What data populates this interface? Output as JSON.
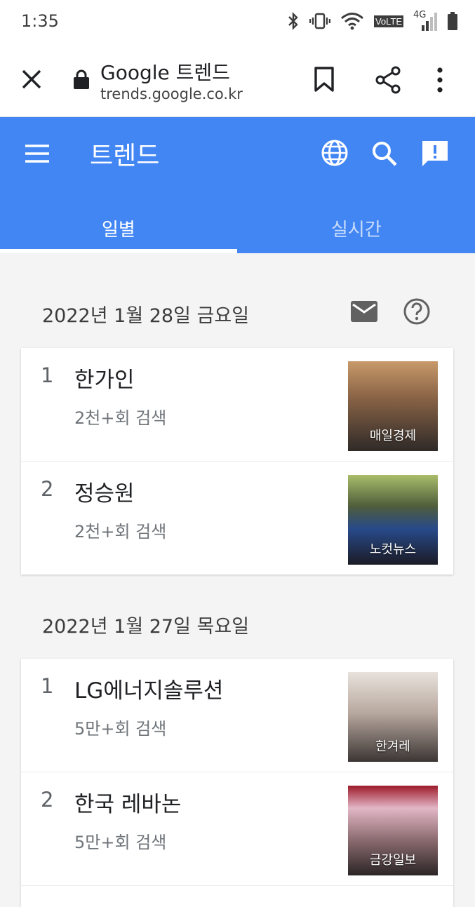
{
  "status_bar": {
    "time": "1:35",
    "network": "4G",
    "volte": "VoLTE",
    "icons": [
      "bluetooth-icon",
      "vibrate-icon",
      "wifi-icon",
      "volte-icon",
      "signal-icon",
      "battery-icon"
    ]
  },
  "browser": {
    "page_title": "Google 트렌드",
    "url": "trends.google.co.kr",
    "icons": [
      "close-icon",
      "lock-icon",
      "bookmark-icon",
      "share-icon",
      "more-icon"
    ]
  },
  "app": {
    "title": "트렌드",
    "tabs": [
      {
        "label": "일별",
        "active": true
      },
      {
        "label": "실시간",
        "active": false
      }
    ],
    "icons": [
      "menu-icon",
      "globe-icon",
      "search-icon",
      "feedback-icon"
    ]
  },
  "sections": [
    {
      "date": "2022년 1월 28일 금요일",
      "items": [
        {
          "rank": "1",
          "term": "한가인",
          "searches": "2천+회 검색",
          "source": "매일경제"
        },
        {
          "rank": "2",
          "term": "정승원",
          "searches": "2천+회 검색",
          "source": "노컷뉴스"
        }
      ]
    },
    {
      "date": "2022년 1월 27일 목요일",
      "items": [
        {
          "rank": "1",
          "term": "LG에너지솔루션",
          "searches": "5만+회 검색",
          "source": "한겨레"
        },
        {
          "rank": "2",
          "term": "한국 레바논",
          "searches": "5만+회 검색",
          "source": "금강일보"
        }
      ]
    }
  ],
  "colors": {
    "header_blue": "#4286f4",
    "background": "#f4f4f4"
  }
}
